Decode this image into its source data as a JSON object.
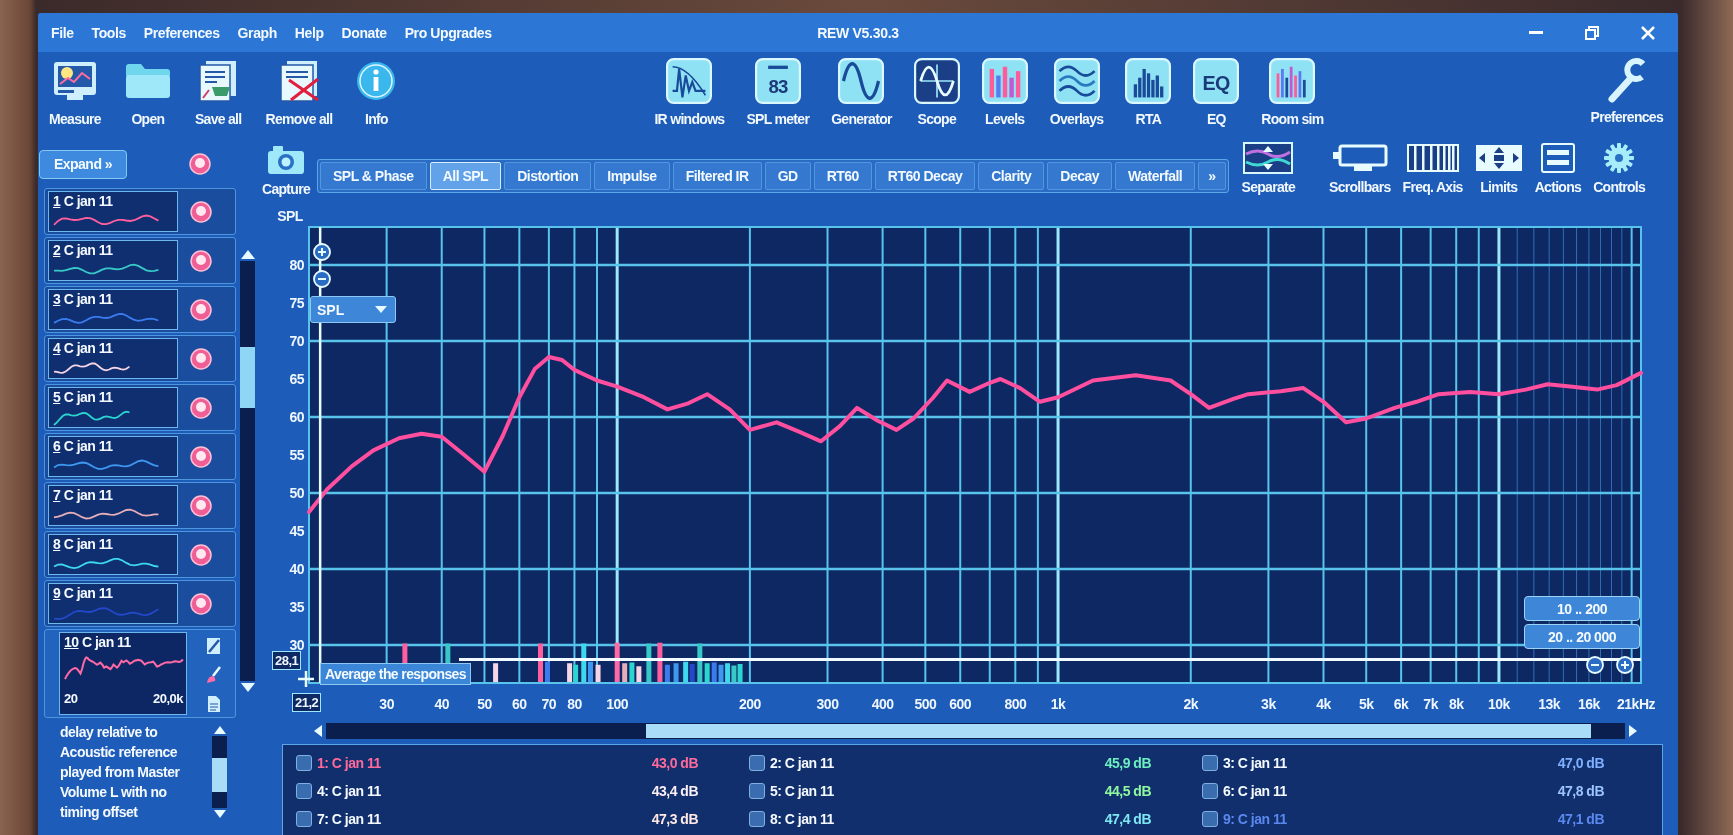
{
  "window": {
    "title": "REW V5.30.3"
  },
  "menu": [
    "File",
    "Tools",
    "Preferences",
    "Graph",
    "Help",
    "Donate",
    "Pro Upgrades"
  ],
  "toolbar": {
    "file_actions": [
      {
        "kind": "measure",
        "label": "Measure"
      },
      {
        "kind": "open",
        "label": "Open"
      },
      {
        "kind": "save",
        "label": "Save all"
      },
      {
        "kind": "remove",
        "label": "Remove all"
      },
      {
        "kind": "info",
        "label": "Info"
      }
    ],
    "tools": [
      {
        "kind": "ir-windows",
        "label": "IR windows"
      },
      {
        "kind": "spl-meter",
        "label": "SPL meter",
        "icon_text": "83"
      },
      {
        "kind": "generator",
        "label": "Generator"
      },
      {
        "kind": "scope",
        "label": "Scope"
      },
      {
        "kind": "levels",
        "label": "Levels"
      },
      {
        "kind": "overlays",
        "label": "Overlays"
      },
      {
        "kind": "rta",
        "label": "RTA"
      },
      {
        "kind": "eq",
        "label": "EQ",
        "icon_text": "EQ"
      },
      {
        "kind": "room-sim",
        "label": "Room sim"
      }
    ],
    "settings": [
      {
        "kind": "preferences",
        "label": "Preferences"
      }
    ]
  },
  "measurements": {
    "expand_label": "Expand »",
    "items": [
      {
        "number": "1",
        "name": "C jan 11",
        "color": "#ff5f9e",
        "selected": false
      },
      {
        "number": "2",
        "name": "C jan 11",
        "color": "#38c8c8",
        "selected": false
      },
      {
        "number": "3",
        "name": "C jan 11",
        "color": "#3a7cf0",
        "selected": false
      },
      {
        "number": "4",
        "name": "C jan 11",
        "color": "#f6d6e6",
        "selected": false
      },
      {
        "number": "5",
        "name": "C jan 11",
        "color": "#2cd6d0",
        "selected": false
      },
      {
        "number": "6",
        "name": "C jan 11",
        "color": "#3e98f0",
        "selected": false
      },
      {
        "number": "7",
        "name": "C jan 11",
        "color": "#e6aeb8",
        "selected": false
      },
      {
        "number": "8",
        "name": "C jan 11",
        "color": "#3ed8ee",
        "selected": false
      },
      {
        "number": "9",
        "name": "C jan 11",
        "color": "#2348c8",
        "selected": false
      },
      {
        "number": "10",
        "name": "C jan 11",
        "color": "#ff6aa6",
        "selected": true,
        "range_start": "20",
        "range_end": "20,0k"
      }
    ],
    "notes": "delay relative to Acoustic reference played from Master Volume L with no timing offset"
  },
  "graph_toolbar": {
    "capture": "Capture",
    "tabs": [
      {
        "label": "SPL & Phase",
        "selected": false
      },
      {
        "label": "All SPL",
        "selected": true
      },
      {
        "label": "Distortion",
        "selected": false
      },
      {
        "label": "Impulse",
        "selected": false
      },
      {
        "label": "Filtered IR",
        "selected": false
      },
      {
        "label": "GD",
        "selected": false
      },
      {
        "label": "RT60",
        "selected": false
      },
      {
        "label": "RT60 Decay",
        "selected": false
      },
      {
        "label": "Clarity",
        "selected": false
      },
      {
        "label": "Decay",
        "selected": false
      },
      {
        "label": "Waterfall",
        "selected": false
      }
    ],
    "more_tabs": "»",
    "tools": [
      {
        "kind": "separate",
        "label": "Separate"
      },
      {
        "kind": "scrollbars",
        "label": "Scrollbars"
      },
      {
        "kind": "freq-axis",
        "label": "Freq. Axis"
      },
      {
        "kind": "limits",
        "label": "Limits"
      },
      {
        "kind": "actions",
        "label": "Actions"
      },
      {
        "kind": "controls",
        "label": "Controls"
      }
    ]
  },
  "graph": {
    "y_selector": "SPL",
    "cursor_level": "28,1",
    "cursor_frequency": "21,2",
    "tooltip": "Average the responses",
    "range_buttons": [
      "10 .. 200",
      "20 .. 20 000"
    ],
    "chart_data": {
      "type": "line",
      "ylabel": "SPL",
      "xlabel": "Hz",
      "log": "x",
      "grid": true,
      "x": [
        20,
        22,
        25,
        28,
        32,
        36,
        40,
        45,
        50,
        55,
        60,
        65,
        70,
        75,
        80,
        90,
        100,
        115,
        130,
        145,
        160,
        180,
        200,
        230,
        260,
        290,
        320,
        350,
        390,
        430,
        470,
        520,
        560,
        630,
        700,
        740,
        820,
        910,
        1000,
        1200,
        1500,
        1800,
        2000,
        2200,
        2500,
        2700,
        3200,
        3600,
        4000,
        4500,
        5000,
        5800,
        6500,
        7300,
        8600,
        10000,
        11500,
        12900,
        14500,
        16700,
        18500,
        21000
      ],
      "series": [
        {
          "color": "#ff4f9e",
          "values": [
            47.5,
            50.5,
            53.5,
            55.6,
            57.2,
            57.8,
            57.4,
            55.0,
            52.8,
            57.5,
            62.6,
            66.3,
            67.9,
            67.5,
            66.2,
            64.8,
            64.0,
            62.6,
            61.0,
            61.8,
            63.0,
            61.0,
            58.3,
            59.3,
            58.0,
            56.8,
            58.8,
            61.2,
            59.5,
            58.3,
            59.8,
            62.5,
            64.8,
            63.3,
            64.5,
            65.0,
            63.8,
            62.0,
            62.6,
            64.8,
            65.5,
            64.8,
            63.0,
            61.2,
            62.4,
            63.0,
            63.4,
            63.8,
            62.0,
            59.3,
            59.8,
            61.2,
            62.0,
            63.0,
            63.3,
            63.0,
            63.6,
            64.3,
            64.0,
            63.6,
            64.2,
            65.8
          ]
        }
      ],
      "xlim": [
        20,
        21000
      ],
      "ylim": [
        25,
        85
      ],
      "xticks": [
        30,
        40,
        50,
        60,
        70,
        80,
        100,
        200,
        300,
        400,
        500,
        600,
        800,
        {
          "value": 1000,
          "label": "1k"
        },
        {
          "value": 2000,
          "label": "2k"
        },
        {
          "value": 3000,
          "label": "3k"
        },
        {
          "value": 4000,
          "label": "4k"
        },
        {
          "value": 5000,
          "label": "5k"
        },
        {
          "value": 6000,
          "label": "6k"
        },
        {
          "value": 7000,
          "label": "7k"
        },
        {
          "value": 8000,
          "label": "8k"
        },
        {
          "value": 10000,
          "label": "10k"
        },
        {
          "value": 13000,
          "label": "13k"
        },
        {
          "value": 16000,
          "label": "16k"
        },
        {
          "value": 21000,
          "label": "21k"
        }
      ],
      "yticks": [
        30,
        35,
        40,
        45,
        50,
        55,
        60,
        65,
        70,
        75,
        80
      ]
    }
  },
  "legend": [
    {
      "name": "1: C jan 11",
      "value": "43,0 dB",
      "color": "#ff6a9c",
      "tinted": true,
      "checked": false
    },
    {
      "name": "2: C jan 11",
      "value": "45,9 dB",
      "color": "#6cf0c0",
      "tinted": false,
      "checked": false
    },
    {
      "name": "3: C jan 11",
      "value": "47,0 dB",
      "color": "#7fb0ff",
      "tinted": false,
      "checked": false
    },
    {
      "name": "4: C jan 11",
      "value": "43,4 dB",
      "color": "#fbeef6",
      "tinted": false,
      "checked": false
    },
    {
      "name": "5: C jan 11",
      "value": "44,5 dB",
      "color": "#8ef7a0",
      "tinted": false,
      "checked": false
    },
    {
      "name": "6: C jan 11",
      "value": "47,8 dB",
      "color": "#9cc4ff",
      "tinted": false,
      "checked": false
    },
    {
      "name": "7: C jan 11",
      "value": "47,3 dB",
      "color": "#ffe9e4",
      "tinted": false,
      "checked": false
    },
    {
      "name": "8: C jan 11",
      "value": "47,4 dB",
      "color": "#7ce6f2",
      "tinted": false,
      "checked": false
    },
    {
      "name": "9: C jan 11",
      "value": "47,1 dB",
      "color": "#5a88ee",
      "tinted": true,
      "checked": false
    }
  ]
}
